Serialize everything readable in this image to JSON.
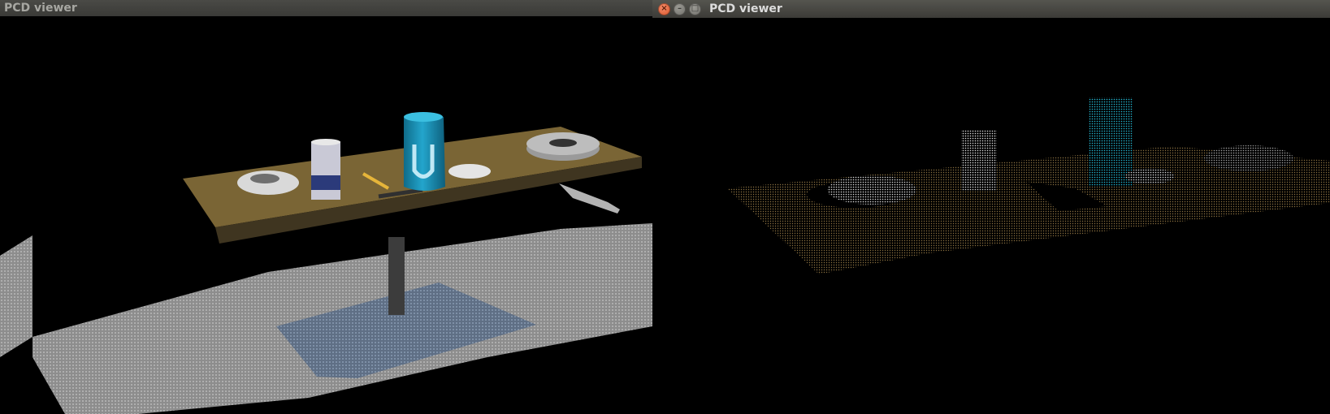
{
  "windows": [
    {
      "title": "PCD viewer"
    },
    {
      "title": "PCD viewer"
    }
  ],
  "right_window": {
    "controls": {
      "close_icon": "×",
      "minimize_icon": "–",
      "maximize_icon": "□"
    }
  },
  "colors": {
    "table_top": "#7a6535",
    "floor_gray": "#9a9a9a",
    "floor_shadow": "#61738a",
    "can_blue": "#1a8fb3",
    "cloud_cyan": "#22b5d0",
    "cloud_table": "#8a7040"
  }
}
